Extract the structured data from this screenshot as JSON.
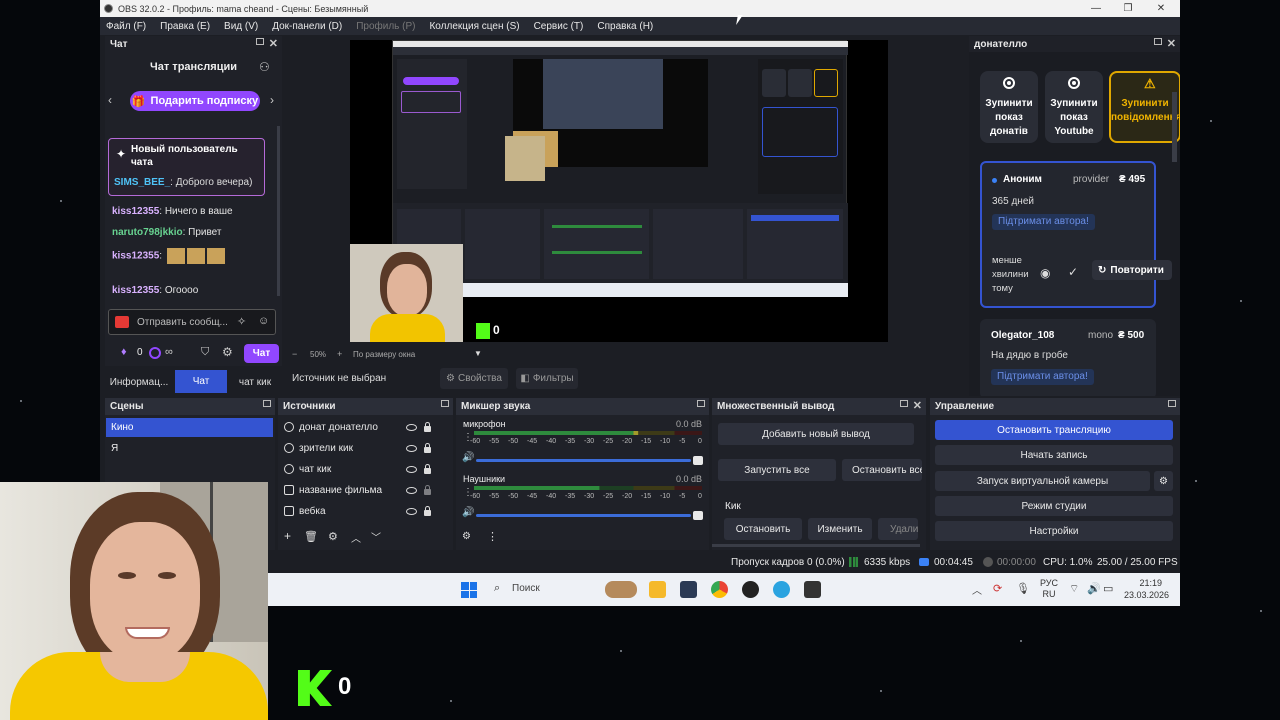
{
  "titlebar": {
    "title": "OBS 32.0.2 - Профиль: mama cheand - Сцены: Безымянный",
    "minimize": "—",
    "maximize": "❐",
    "close": "✕"
  },
  "menu": [
    "Файл (F)",
    "Правка (E)",
    "Вид (V)",
    "Док-панели (D)",
    "Профиль (P)",
    "Коллекция сцен (S)",
    "Сервис (T)",
    "Справка (H)"
  ],
  "chat": {
    "dock_title": "Чат",
    "header": "Чат трансляции",
    "gift_button": "Подарить подписку",
    "new_user_title": "Новый пользователь чата",
    "lines": [
      {
        "user": "SIMS_BEE_",
        "text": ": Доброго вечера)"
      },
      {
        "user": "kiss12355",
        "text": ": Ничего в ваше"
      },
      {
        "user": "naruto798jkkio",
        "text": ": Привет"
      },
      {
        "user": "kiss12355",
        "text": ":"
      },
      {
        "user": "kiss12355",
        "text": ": Огоооо"
      }
    ],
    "input_placeholder": "Отправить сообщ...",
    "points": "0",
    "infinity": "∞",
    "chat_button": "Чат",
    "tabs": [
      "Информац...",
      "Чат",
      "чат кик"
    ]
  },
  "preview": {
    "zoom": "50%",
    "fit_label": "По размеру окна",
    "kick_count": "0"
  },
  "source_bar": {
    "no_source": "Источник не выбран",
    "properties": "Свойства",
    "filters": "Фильтры"
  },
  "donatello": {
    "dock_title": "донателло",
    "buttons": [
      "Зупинити показ донатів",
      "Зупинити показ Youtube",
      "Зупинити повідомлення"
    ],
    "card1": {
      "name": "Аноним",
      "provider": "provider",
      "amount": "₴ 495",
      "message": "365 дней",
      "support": "Підтримати автора!",
      "time": "менше хвилини тому",
      "repeat": "Повторити"
    },
    "card2": {
      "name": "Olegator_108",
      "provider": "mono",
      "amount": "₴ 500",
      "message": "На дядю в гробе",
      "support": "Підтримати автора!"
    }
  },
  "scenes": {
    "title": "Сцены",
    "items": [
      "Кино",
      "Я"
    ]
  },
  "sources": {
    "title": "Источники",
    "items": [
      "донат донателло",
      "зрители кик",
      "чат кик",
      "название фильма",
      "вебка"
    ]
  },
  "mixer": {
    "title": "Микшер звука",
    "channels": [
      {
        "name": "микрофон",
        "db": "0.0 dB",
        "level": 0.72
      },
      {
        "name": "Наушники",
        "db": "0.0 dB",
        "level": 0.55
      }
    ],
    "ticks": [
      "-60",
      "-55",
      "-50",
      "-45",
      "-40",
      "-35",
      "-30",
      "-25",
      "-20",
      "-15",
      "-10",
      "-5",
      "0"
    ]
  },
  "multi": {
    "title": "Множественный вывод",
    "add": "Добавить новый вывод",
    "start_all": "Запустить все",
    "stop_all": "Остановить все",
    "target": "Кик",
    "stop": "Остановить",
    "edit": "Изменить",
    "delete": "Удали"
  },
  "controls": {
    "title": "Управление",
    "stop_stream": "Остановить трансляцию",
    "record": "Начать запись",
    "virtual_cam": "Запуск виртуальной камеры",
    "studio": "Режим студии",
    "settings": "Настройки"
  },
  "status": {
    "dropped": "Пропуск кадров 0 (0.0%)",
    "bitrate": "6335 kbps",
    "stream_time": "00:04:45",
    "rec_time": "00:00:00",
    "cpu": "CPU: 1.0%",
    "fps": "25.00 / 25.00 FPS"
  },
  "taskbar": {
    "search": "Поиск",
    "lang1": "РУС",
    "lang2": "RU",
    "time": "21:19",
    "date": "23.03.2026"
  },
  "overlay": {
    "kick_count": "0"
  },
  "colors": {
    "accent": "#3454d1",
    "kick": "#53fc18",
    "twitch": "#9147ff"
  }
}
